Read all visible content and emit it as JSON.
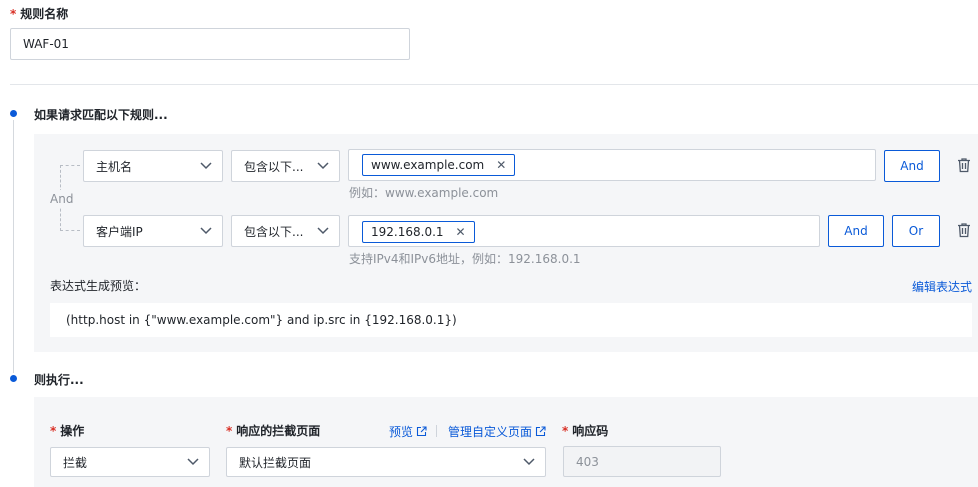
{
  "rule_name": {
    "label": "规则名称",
    "value": "WAF-01"
  },
  "match_section": {
    "title": "如果请求匹配以下规则...",
    "and_connector": "And",
    "conditions": [
      {
        "field": "主机名",
        "operator": "包含以下...",
        "tag": "www.example.com",
        "hint": "例如：www.example.com",
        "buttons": [
          "And"
        ]
      },
      {
        "field": "客户端IP",
        "operator": "包含以下...",
        "tag": "192.168.0.1",
        "hint": "支持IPv4和IPv6地址，例如：192.168.0.1",
        "buttons": [
          "And",
          "Or"
        ]
      }
    ],
    "expression_label": "表达式生成预览：",
    "edit_expression": "编辑表达式",
    "expression": "(http.host in {\"www.example.com\"} and ip.src in {192.168.0.1})"
  },
  "action_section": {
    "title": "则执行...",
    "operation": {
      "label": "操作",
      "value": "拦截"
    },
    "block_page": {
      "label": "响应的拦截页面",
      "value": "默认拦截页面",
      "preview_link": "预览",
      "manage_link": "管理自定义页面"
    },
    "response_code": {
      "label": "响应码",
      "value": "403"
    }
  },
  "colors": {
    "accent": "#0a5ad8",
    "required": "#d93026",
    "panel": "#f5f6f8"
  }
}
